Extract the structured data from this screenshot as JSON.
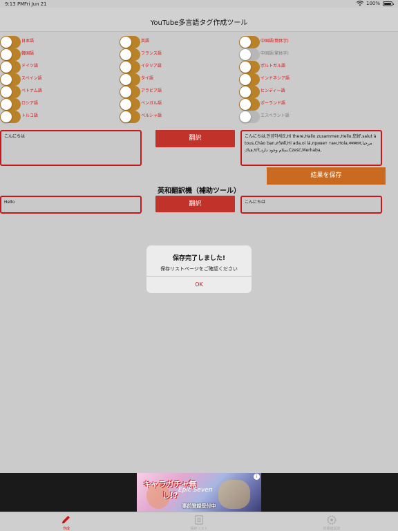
{
  "status_bar": {
    "time": "9:13 PM",
    "date": "Fri Jun 21",
    "battery": "100%"
  },
  "header": {
    "title": "YouTube多言語タグ作成ツール"
  },
  "languages": [
    [
      {
        "label": "日本語",
        "on": true
      },
      {
        "label": "英語",
        "on": true
      },
      {
        "label": "中国語(簡体字)",
        "on": true
      }
    ],
    [
      {
        "label": "韓国語",
        "on": true
      },
      {
        "label": "フランス語",
        "on": true
      },
      {
        "label": "中国語(繁体字)",
        "on": false
      }
    ],
    [
      {
        "label": "ドイツ語",
        "on": true
      },
      {
        "label": "イタリア語",
        "on": true
      },
      {
        "label": "ポルトガル語",
        "on": true
      }
    ],
    [
      {
        "label": "スペイン語",
        "on": true
      },
      {
        "label": "タイ語",
        "on": true
      },
      {
        "label": "インドネシア語",
        "on": true
      }
    ],
    [
      {
        "label": "ベトナム語",
        "on": true
      },
      {
        "label": "アラビア語",
        "on": true
      },
      {
        "label": "ヒンディー語",
        "on": true
      }
    ],
    [
      {
        "label": "ロシア語",
        "on": true
      },
      {
        "label": "ベンガル語",
        "on": true
      },
      {
        "label": "ポーランド語",
        "on": true
      }
    ],
    [
      {
        "label": "トルコ語",
        "on": true
      },
      {
        "label": "ペルシャ語",
        "on": true
      },
      {
        "label": "エスペラント語",
        "on": false
      }
    ]
  ],
  "multi": {
    "input_value": "こんにちは",
    "translate_label": "翻訳",
    "output_value": "こんにちは,안녕하세요,Hi there,Hallo zusammen,Hello,您好,salut à tous,Chào bạn,สวัสดี,Hi ada,oi lá,привет там,Hola,नमस्कार,مرحبا هناك,হাই,سلام وجود دارد,Cześć,Merhaba,",
    "save_label": "結果を保存"
  },
  "en_ja": {
    "title": "英和翻訳機（補助ツール）",
    "input_value": "Hello",
    "translate_label": "翻訳",
    "output_value": "こんにちは"
  },
  "alert": {
    "title": "保存完了しました!",
    "message": "保存リストページをご確認ください",
    "ok_label": "OK"
  },
  "ad": {
    "catch": "キャラガチャ無し!?",
    "logo": "Epic Seven",
    "footer": "事前登録受付中",
    "info": "i"
  },
  "tabbar": {
    "tabs": [
      {
        "label": "作成",
        "icon": "pencil-icon",
        "active": true
      },
      {
        "label": "保存リスト",
        "icon": "list-icon",
        "active": false
      },
      {
        "label": "初期値設定",
        "icon": "gear-icon",
        "active": false
      }
    ]
  },
  "colors": {
    "accent_red": "#c8171b",
    "toggle_on": "#b98128",
    "save_orange": "#c96a20",
    "button_red": "#c0322a"
  }
}
